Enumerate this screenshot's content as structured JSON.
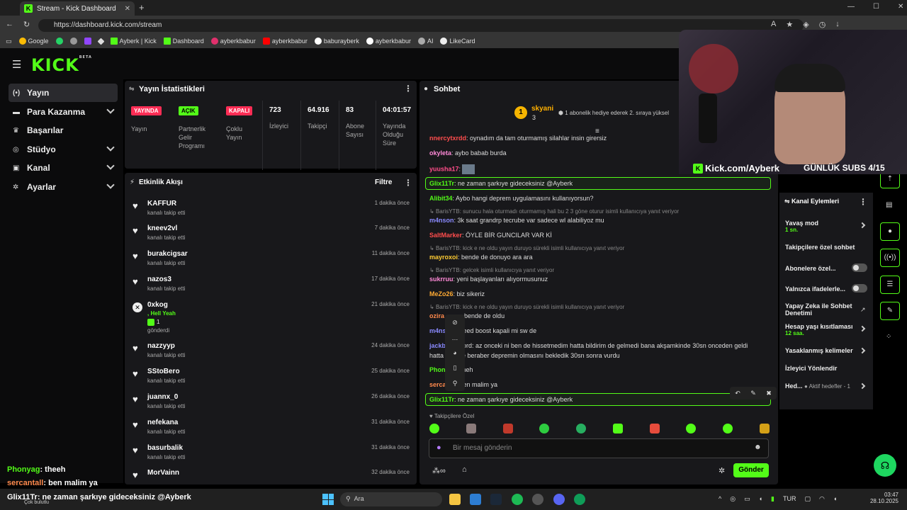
{
  "browser": {
    "tab_title": "Stream - Kick Dashboard",
    "url": "https://dashboard.kick.com/stream",
    "bookmarks": [
      "Google",
      "",
      "",
      "",
      "",
      "Ayberk | Kick",
      "Dashboard",
      "ayberkbabur",
      "ayberkbabur",
      "baburayberk",
      "ayberkbabur",
      "AI",
      "LikeCard"
    ]
  },
  "logo": "KICK",
  "logo_sup": "BETA",
  "nav": [
    "Yayın",
    "Para Kazanma",
    "Başarılar",
    "Stüdyo",
    "Kanal",
    "Ayarlar"
  ],
  "stats": {
    "title": "Yayın İstatistikleri",
    "badges": [
      {
        "text": "YAYINDA",
        "label": "Yayın"
      },
      {
        "text": "AÇIK",
        "label": "Partnerlik Gelir Programı"
      },
      {
        "text": "KAPALI",
        "label": "Çoklu Yayın"
      }
    ],
    "values": [
      {
        "value": "723",
        "label": "İzleyici"
      },
      {
        "value": "64.916",
        "label": "Takipçi"
      },
      {
        "value": "83",
        "label": "Abone Sayısı"
      },
      {
        "value": "04:01:57",
        "label": "Yayında Olduğu Süre"
      }
    ]
  },
  "activity": {
    "title": "Etkinlik Akışı",
    "filter": "Filtre",
    "items": [
      {
        "name": "KAFFUR",
        "sub": "kanalı takip etti",
        "time": "1 dakika önce"
      },
      {
        "name": "kneev2vl",
        "sub": "kanalı takip etti",
        "time": "7 dakika önce"
      },
      {
        "name": "burakcigsar",
        "sub": "kanalı takip etti",
        "time": "11 dakika önce"
      },
      {
        "name": "nazos3",
        "sub": "kanalı takip etti",
        "time": "17 dakika önce"
      },
      {
        "name": "0xkog",
        "sub": "gönderdi",
        "time": "21 dakika önce",
        "extra": ", Hell Yeah",
        "count": "1"
      },
      {
        "name": "nazzyyp",
        "sub": "kanalı takip etti",
        "time": "24 dakika önce"
      },
      {
        "name": "SStoBero",
        "sub": "kanalı takip etti",
        "time": "25 dakika önce"
      },
      {
        "name": "juannx_0",
        "sub": "kanalı takip etti",
        "time": "26 dakika önce"
      },
      {
        "name": "nefekana",
        "sub": "kanalı takip etti",
        "time": "31 dakika önce"
      },
      {
        "name": "basurbalik",
        "sub": "kanalı takip etti",
        "time": "31 dakika önce"
      },
      {
        "name": "MorVainn",
        "sub": "",
        "time": "32 dakika önce"
      }
    ]
  },
  "chat": {
    "title": "Sohbet",
    "top_user": "skyani",
    "top_count": "3",
    "top_msg": "1 abonelik hediye ederek 2. sıraya yüksel",
    "lines": [
      {
        "user": "nnercytxrdd",
        "color": "#ff4d4d",
        "msg": ": oynadım da tam oturmamış silahlar insin girersiz"
      },
      {
        "user": "okyleta",
        "color": "#ff8ad8",
        "msg": ": aybo babab burda"
      },
      {
        "user": "yuusha17",
        "color": "#ff4d8a",
        "msg": ":"
      },
      {
        "user": "Glix11Tr",
        "color": "#53fc18",
        "msg": ": ne zaman şarkıye gideceksiniz @Ayberk"
      },
      {
        "user": "Alibit34",
        "color": "#53fc18",
        "msg": ": Aybo hangi deprem uygulamasını kullanıyorsun?"
      },
      {
        "reply": "BarisYTB: sunucu hala oturmadı oturmamış hali bu 2 3 göne oturur isimli kullanıcıya yanıt veriyor"
      },
      {
        "user": "m4nson",
        "color": "#8a8aff",
        "msg": ": 3k saat grandrp tecrube var sadece wl alabiliyoz mu"
      },
      {
        "user": "SaltMarker",
        "color": "#ff4d4d",
        "msg": ": ÖYLE BİR GUNCILAR VAR Kİ"
      },
      {
        "reply": "BarisYTB: kick e ne oldu yayın duruyo sürekli isimli kullanıcıya yanıt veriyor"
      },
      {
        "user": "mayroxoi",
        "color": "#ffcc33",
        "msg": ": bende de donuyo ara ara"
      },
      {
        "reply": "BarisYTB: gelcek isimli kullanıcıya yanıt veriyor"
      },
      {
        "user": "sukrruu",
        "color": "#ff8ad8",
        "msg": ": yeni başlayanları alıyormusunuz"
      },
      {
        "user": "MeZo26",
        "color": "#ffaa33",
        "msg": ": biz sikeriz"
      },
      {
        "reply": "BarisYTB: kick e ne oldu yayın duruyo sürekli isimli kullanıcıya yanıt veriyor"
      },
      {
        "user": "ozira",
        "color": "#ff8a4d",
        "msg": "bende de oldu"
      },
      {
        "user": "m4ns",
        "color": "#8a8aff",
        "msg": "eed boost kapali mi sw de"
      },
      {
        "user": "jackb",
        "color": "#8a8aff",
        "msg": "ord: az onceki ni ben de hissetmedim hatta bildirim de gelmedi bana akşamkinde 30sn onceden geldi"
      },
      {
        "user": "hatta",
        "color": "#dddddd",
        "msg": "le beraber depremin olmasını bekledik 30sn sonra vurdu"
      },
      {
        "user": "Phon",
        "color": "#53fc18",
        "msg": "heh"
      },
      {
        "user": "serca",
        "color": "#ff8a4d",
        "msg": "en malim ya"
      },
      {
        "user": "Glix11Tr",
        "color": "#53fc18",
        "msg": ": ne zaman şarkıye gideceksiniz @Ayberk"
      }
    ],
    "follower_label": "Takipçilere Özel",
    "input_placeholder": "Bir mesaj gönderin",
    "send": "Gönder"
  },
  "kanal": {
    "title": "Kanal Eylemleri",
    "items": [
      {
        "label": "Yavaş mod",
        "sub": "1 sn."
      },
      {
        "label": "Takipçilere özel sohbet",
        "sub": ""
      },
      {
        "label": "Abonelere özel...",
        "sub": ""
      },
      {
        "label": "Yalnızca ifadelerle...",
        "sub": ""
      },
      {
        "label": "Yapay Zeka ile Sohbet Denetimi",
        "sub": ""
      },
      {
        "label": "Hesap yaşı kısıtlaması",
        "sub": "12 saa."
      },
      {
        "label": "Yasaklanmış kelimeler",
        "sub": ""
      },
      {
        "label": "İzleyici Yönlendir",
        "sub": ""
      },
      {
        "label": "Hed...",
        "sub": "Aktif hedefler - 1"
      }
    ]
  },
  "overlay": {
    "brand": "Kick.com/Ayberk",
    "subs": "GÜNLÜK SUBS 4/15",
    "chat": [
      {
        "user": "Phonyag",
        "msg": ": theeh",
        "color": "#53fc18"
      },
      {
        "user": "sercantall",
        "msg": ": ben malim ya",
        "color": "#ff8a4d"
      },
      {
        "user": "Glix11Tr",
        "msg": ": ne zaman şarkıye gideceksiniz @Ayberk",
        "color": "#ffffff"
      }
    ],
    "weather": "Çok bulutlu"
  },
  "taskbar": {
    "search": "Ara",
    "lang": "TUR",
    "time": "03:47",
    "date": "28.10.2025"
  }
}
